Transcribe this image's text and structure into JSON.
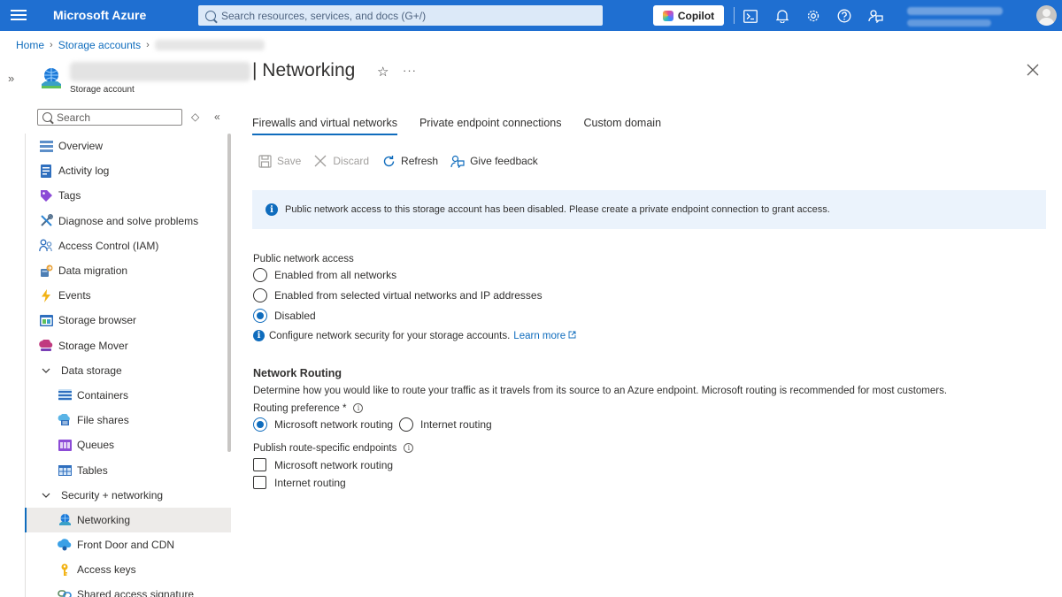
{
  "topbar": {
    "brand": "Microsoft Azure",
    "search_placeholder": "Search resources, services, and docs (G+/)",
    "copilot_label": "Copilot",
    "icons": [
      "cloud-shell-icon",
      "bell-icon",
      "gear-icon",
      "help-icon",
      "feedback-icon"
    ]
  },
  "breadcrumb": {
    "home": "Home",
    "storage_accounts": "Storage accounts"
  },
  "header": {
    "title": "| Networking",
    "subtitle": "Storage account",
    "star": "☆",
    "more": "···"
  },
  "sidebar": {
    "search_placeholder": "Search",
    "items": [
      {
        "label": "Overview",
        "icon": "overview-icon"
      },
      {
        "label": "Activity log",
        "icon": "activity-log-icon"
      },
      {
        "label": "Tags",
        "icon": "tag-icon"
      },
      {
        "label": "Diagnose and solve problems",
        "icon": "wrench-icon"
      },
      {
        "label": "Access Control (IAM)",
        "icon": "people-icon"
      },
      {
        "label": "Data migration",
        "icon": "data-migration-icon"
      },
      {
        "label": "Events",
        "icon": "lightning-icon"
      },
      {
        "label": "Storage browser",
        "icon": "storage-browser-icon"
      },
      {
        "label": "Storage Mover",
        "icon": "storage-mover-icon"
      },
      {
        "label": "Data storage",
        "icon": "chevron-down-icon"
      },
      {
        "label": "Containers",
        "icon": "containers-icon"
      },
      {
        "label": "File shares",
        "icon": "file-shares-icon"
      },
      {
        "label": "Queues",
        "icon": "queues-icon"
      },
      {
        "label": "Tables",
        "icon": "tables-icon"
      },
      {
        "label": "Security + networking",
        "icon": "chevron-down-icon"
      },
      {
        "label": "Networking",
        "icon": "networking-icon"
      },
      {
        "label": "Front Door and CDN",
        "icon": "cdn-icon"
      },
      {
        "label": "Access keys",
        "icon": "key-icon"
      },
      {
        "label": "Shared access signature",
        "icon": "link-icon"
      }
    ]
  },
  "tabs": [
    {
      "label": "Firewalls and virtual networks",
      "active": true
    },
    {
      "label": "Private endpoint connections",
      "active": false
    },
    {
      "label": "Custom domain",
      "active": false
    }
  ],
  "toolbar": {
    "save": "Save",
    "discard": "Discard",
    "refresh": "Refresh",
    "feedback": "Give feedback"
  },
  "banner": {
    "text": "Public network access to this storage account has been disabled. Please create a private endpoint connection to grant access."
  },
  "public_access": {
    "label": "Public network access",
    "options": [
      {
        "label": "Enabled from all networks",
        "selected": false
      },
      {
        "label": "Enabled from selected virtual networks and IP addresses",
        "selected": false
      },
      {
        "label": "Disabled",
        "selected": true
      }
    ],
    "hint": "Configure network security for your storage accounts.",
    "learn_more": "Learn more"
  },
  "routing": {
    "title": "Network Routing",
    "description": "Determine how you would like to route your traffic as it travels from its source to an Azure endpoint. Microsoft routing is recommended for most customers.",
    "preference_label": "Routing preference *",
    "preference_options": [
      {
        "label": "Microsoft network routing",
        "selected": true
      },
      {
        "label": "Internet routing",
        "selected": false
      }
    ],
    "publish_label": "Publish route-specific endpoints",
    "publish_options": [
      {
        "label": "Microsoft network routing",
        "checked": false
      },
      {
        "label": "Internet routing",
        "checked": false
      }
    ]
  },
  "colors": {
    "topbar": "#1f6fd1",
    "accent": "#0f6cbd",
    "banner": "#ebf3fc"
  }
}
